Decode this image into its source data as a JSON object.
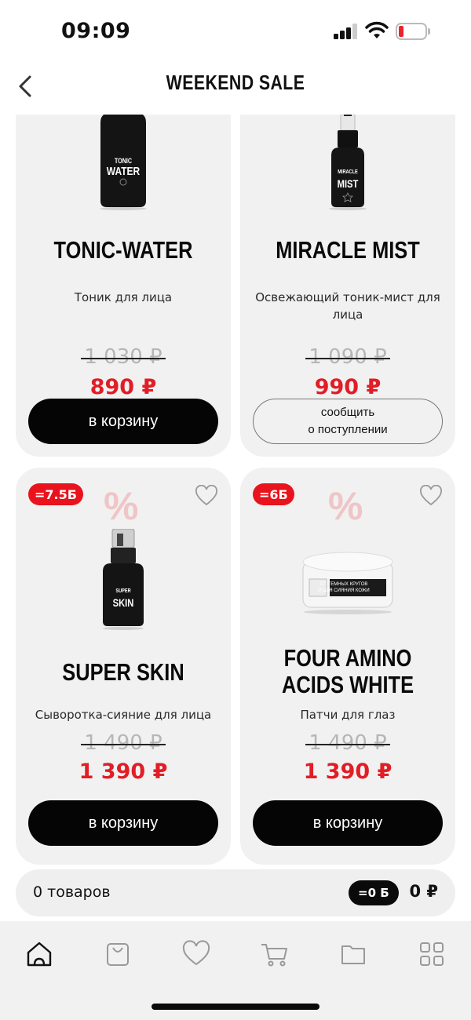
{
  "status_bar": {
    "time": "09:09"
  },
  "header": {
    "title": "WEEKEND SALE",
    "back_icon": "chevron-left-icon"
  },
  "products": [
    {
      "name": "TONIC-WATER",
      "description": "Тоник для лица",
      "old_price": "1 030 ₽",
      "new_price": "890 ₽",
      "button": "в корзину",
      "bottle_text_1": "TONIC",
      "bottle_text_2": "WATER"
    },
    {
      "name": "MIRACLE MIST",
      "description": "Освежающий тоник-мист для лица",
      "old_price": "1 090 ₽",
      "new_price": "990 ₽",
      "button_line1": "сообщить",
      "button_line2": "о поступлении",
      "bottle_text_1": "MIRACLE",
      "bottle_text_2": "MIST"
    },
    {
      "badge": "=7.5Б",
      "discount_icon": "percent-icon",
      "name": "SUPER SKIN",
      "description": "Сыворотка-сияние для лица",
      "old_price": "1 490 ₽",
      "new_price": "1 390 ₽",
      "button": "в корзину",
      "bottle_text_1": "SUPER",
      "bottle_text_2": "SKIN"
    },
    {
      "badge": "=6Б",
      "discount_icon": "percent-icon",
      "name_line1": "FOUR AMINO",
      "name_line2": "ACIDS WHITE",
      "description": "Патчи для глаз",
      "old_price": "1 490 ₽",
      "new_price": "1 390 ₽",
      "button": "в корзину",
      "jar_text_1": "ОТ ТЕМНЫХ КРУГОВ",
      "jar_text_2": "И ДЛЯ СИЯНИЯ КОЖИ"
    }
  ],
  "summary": {
    "count": "0 товаров",
    "bonus": "=0 Б",
    "total": "0 ₽"
  },
  "tab_bar": [
    "home-icon",
    "bag-icon",
    "heart-icon",
    "cart-icon",
    "folder-icon",
    "grid-icon"
  ],
  "colors": {
    "accent": "#e11d26",
    "button": "#050505",
    "card": "#f1f1f1"
  }
}
